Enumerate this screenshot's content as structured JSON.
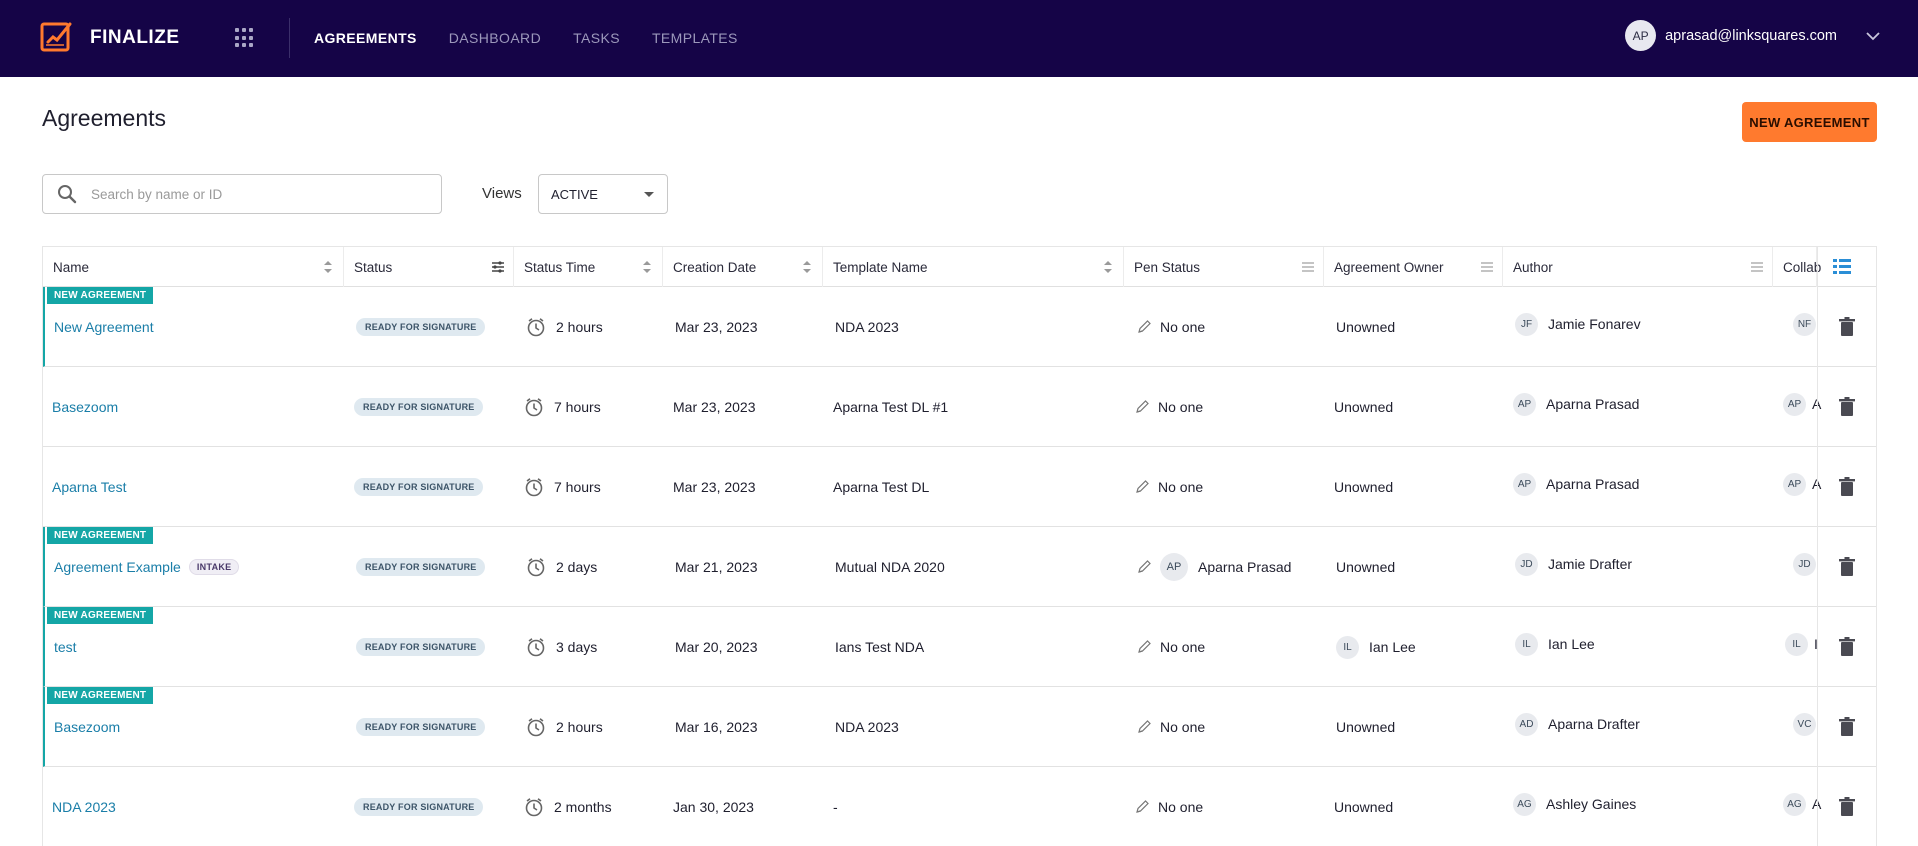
{
  "app": {
    "brand": "FINALIZE",
    "nav": [
      {
        "label": "AGREEMENTS",
        "active": true
      },
      {
        "label": "DASHBOARD",
        "active": false
      },
      {
        "label": "TASKS",
        "active": false
      },
      {
        "label": "TEMPLATES",
        "active": false
      }
    ],
    "user": {
      "initials": "AP",
      "email": "aprasad@linksquares.com"
    },
    "colors": {
      "nav_bg": "#150447",
      "accent_orange": "#ff7a2e",
      "new_badge_teal": "#14a6a6",
      "link_blue": "#1a7ea8"
    }
  },
  "page": {
    "title": "Agreements",
    "new_button": "NEW AGREEMENT",
    "search_placeholder": "Search by name or ID",
    "views_label": "Views",
    "views_value": "ACTIVE"
  },
  "table": {
    "headers": [
      {
        "label": "Name",
        "icon": "sort-icon"
      },
      {
        "label": "Status",
        "icon": "filter-icon"
      },
      {
        "label": "Status Time",
        "icon": "sort-icon"
      },
      {
        "label": "Creation Date",
        "icon": "sort-icon"
      },
      {
        "label": "Template Name",
        "icon": "sort-icon"
      },
      {
        "label": "Pen Status",
        "icon": "menu-icon"
      },
      {
        "label": "Agreement Owner",
        "icon": "menu-icon"
      },
      {
        "label": "Author",
        "icon": "menu-icon"
      },
      {
        "label": "Collab",
        "icon": ""
      }
    ],
    "new_badge_label": "NEW AGREEMENT",
    "rows": [
      {
        "new": true,
        "name": "New Agreement",
        "tag": "",
        "status": "READY FOR SIGNATURE",
        "status_time": "2 hours",
        "created": "Mar 23, 2023",
        "template": "NDA 2023",
        "pen_initials": "",
        "pen": "No one",
        "owner_initials": "",
        "owner": "Unowned",
        "author_initials": "JF",
        "author": "Jamie Fonarev",
        "collab_initials": "NF",
        "collab_suffix": ""
      },
      {
        "new": false,
        "name": "Basezoom",
        "tag": "",
        "status": "READY FOR SIGNATURE",
        "status_time": "7 hours",
        "created": "Mar 23, 2023",
        "template": "Aparna Test DL #1",
        "pen_initials": "",
        "pen": "No one",
        "owner_initials": "",
        "owner": "Unowned",
        "author_initials": "AP",
        "author": "Aparna Prasad",
        "collab_initials": "AP",
        "collab_suffix": "A"
      },
      {
        "new": false,
        "name": "Aparna Test",
        "tag": "",
        "status": "READY FOR SIGNATURE",
        "status_time": "7 hours",
        "created": "Mar 23, 2023",
        "template": "Aparna Test DL",
        "pen_initials": "",
        "pen": "No one",
        "owner_initials": "",
        "owner": "Unowned",
        "author_initials": "AP",
        "author": "Aparna Prasad",
        "collab_initials": "AP",
        "collab_suffix": "A"
      },
      {
        "new": true,
        "name": "Agreement Example",
        "tag": "INTAKE",
        "status": "READY FOR SIGNATURE",
        "status_time": "2 days",
        "created": "Mar 21, 2023",
        "template": "Mutual NDA 2020",
        "pen_initials": "AP",
        "pen": "Aparna Prasad",
        "owner_initials": "",
        "owner": "Unowned",
        "author_initials": "JD",
        "author": "Jamie Drafter",
        "collab_initials": "JD",
        "collab_suffix": ""
      },
      {
        "new": true,
        "name": "test",
        "tag": "",
        "status": "READY FOR SIGNATURE",
        "status_time": "3 days",
        "created": "Mar 20, 2023",
        "template": "Ians Test NDA",
        "pen_initials": "",
        "pen": "No one",
        "owner_initials": "IL",
        "owner": "Ian Lee",
        "author_initials": "IL",
        "author": "Ian Lee",
        "collab_initials": "IL",
        "collab_suffix": "I"
      },
      {
        "new": true,
        "name": "Basezoom",
        "tag": "",
        "status": "READY FOR SIGNATURE",
        "status_time": "2 hours",
        "created": "Mar 16, 2023",
        "template": "NDA 2023",
        "pen_initials": "",
        "pen": "No one",
        "owner_initials": "",
        "owner": "Unowned",
        "author_initials": "AD",
        "author": "Aparna Drafter",
        "collab_initials": "VC",
        "collab_suffix": ""
      },
      {
        "new": false,
        "name": "NDA 2023",
        "tag": "",
        "status": "READY FOR SIGNATURE",
        "status_time": "2 months",
        "created": "Jan 30, 2023",
        "template": "-",
        "pen_initials": "",
        "pen": "No one",
        "owner_initials": "",
        "owner": "Unowned",
        "author_initials": "AG",
        "author": "Ashley Gaines",
        "collab_initials": "AG",
        "collab_suffix": "A"
      }
    ]
  }
}
